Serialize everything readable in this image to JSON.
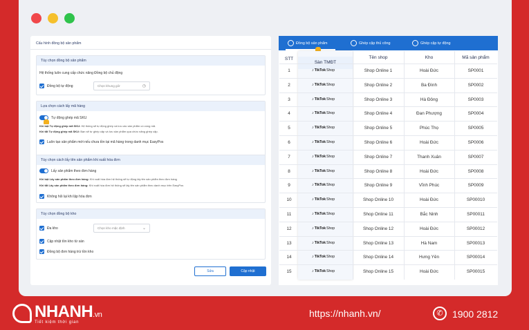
{
  "config": {
    "title": "Cấu hình đồng bộ sản phẩm",
    "sec1": {
      "head": "Tùy chọn đồng bộ sản phẩm",
      "desc": "Hệ thống luôn cung cấp chức năng Đồng bộ chủ động",
      "auto_sync": "Đồng bộ tự động",
      "time_placeholder": "Chọn khung giờ"
    },
    "sec2": {
      "head": "Lựa chọn cách lấy mã hàng",
      "toggle": "Tự động ghép mã SKU",
      "note1_b": "Khi bật Tự động ghép mã SKU:",
      "note1": "Hệ thống sẽ tự động ghép và lưu các sản phẩm có cùng mã.",
      "note2_b": "Khi tắt Tự động ghép mã SKU:",
      "note2": "Bạn sẽ tự ghép cặp và lưu sản phẩm qua chức năng ghép cặp.",
      "create": "Luôn tạo sản phẩm mới nếu chưa tồn tại mã hàng trong danh mục EasyPos"
    },
    "sec3": {
      "head": "Tùy chọn cách lấy tên sản phẩm khi xuất hóa đơn",
      "toggle": "Lấy sản phẩm theo đơn hàng",
      "note1_b": "Khi bật Lấy sản phẩm theo đơn hàng:",
      "note1": "Khi xuất hóa đơn hệ thống sẽ tự động lấy tên sản phẩm theo đơn hàng",
      "note2_b": "Khi tắt Lấy sản phẩm theo đơn hàng:",
      "note2": "Khi xuất hóa đơn hệ thống sẽ lấy tên sản phẩm theo danh mục trên EasyPos",
      "no_show": "Không hỏi lại khi lập hóa đơn"
    },
    "sec4": {
      "head": "Tùy chọn đồng bộ kho",
      "multi": "Đa kho",
      "warehouse_placeholder": "Chọn kho mặc định",
      "update_stock": "Cập nhật tồn kho từ sàn",
      "sync_orders": "Đồng bộ đơn hàng trừ tồn kho"
    },
    "cancel": "Sửa",
    "update": "Cập nhật"
  },
  "tabs": [
    "Đồng bộ sản phẩm",
    "Ghép cặp thủ công",
    "Ghép cặp tự động"
  ],
  "table": {
    "headers": {
      "stt": "STT",
      "tmdt": "Sàn TMĐT",
      "shop": "Tên shop",
      "kho": "Kho",
      "ma": "Mã sản phẩm"
    },
    "tiktok_label": "TikTok",
    "tiktok_shop": "Shop",
    "rows": [
      [
        "1",
        "Shop Online 1",
        "Hoài Đức",
        "SP0001"
      ],
      [
        "2",
        "Shop Online 2",
        "Ba Đình",
        "SP0002"
      ],
      [
        "3",
        "Shop Online 3",
        "Hà Đông",
        "SP0003"
      ],
      [
        "4",
        "Shop Online 4",
        "Đan Phượng",
        "SP0004"
      ],
      [
        "5",
        "Shop Online 5",
        "Phúc Thọ",
        "SP0005"
      ],
      [
        "6",
        "Shop Online 6",
        "Hoài Đức",
        "SP0006"
      ],
      [
        "7",
        "Shop Online 7",
        "Thanh Xuân",
        "SP0007"
      ],
      [
        "8",
        "Shop Online 8",
        "Hoài Đức",
        "SP0008"
      ],
      [
        "9",
        "Shop Online 9",
        "Vĩnh Phúc",
        "SP0009"
      ],
      [
        "10",
        "Shop Online 10",
        "Hoài Đức",
        "SP00010"
      ],
      [
        "11",
        "Shop Online 11",
        "Bắc Ninh",
        "SP00011"
      ],
      [
        "12",
        "Shop Online 12",
        "Hoài Đức",
        "SP00012"
      ],
      [
        "13",
        "Shop Online 13",
        "Hà Nam",
        "SP00013"
      ],
      [
        "14",
        "Shop Online 14",
        "Hưng Yên",
        "SP00014"
      ],
      [
        "15",
        "Shop Online 15",
        "Hoài Đức",
        "SP00015"
      ]
    ]
  },
  "footer": {
    "brand": "NHANH",
    "brand_suffix": ".vn",
    "slogan": "Tiết kiệm thời gian",
    "website": "https://nhanh.vn/",
    "phone": "1900 2812"
  }
}
